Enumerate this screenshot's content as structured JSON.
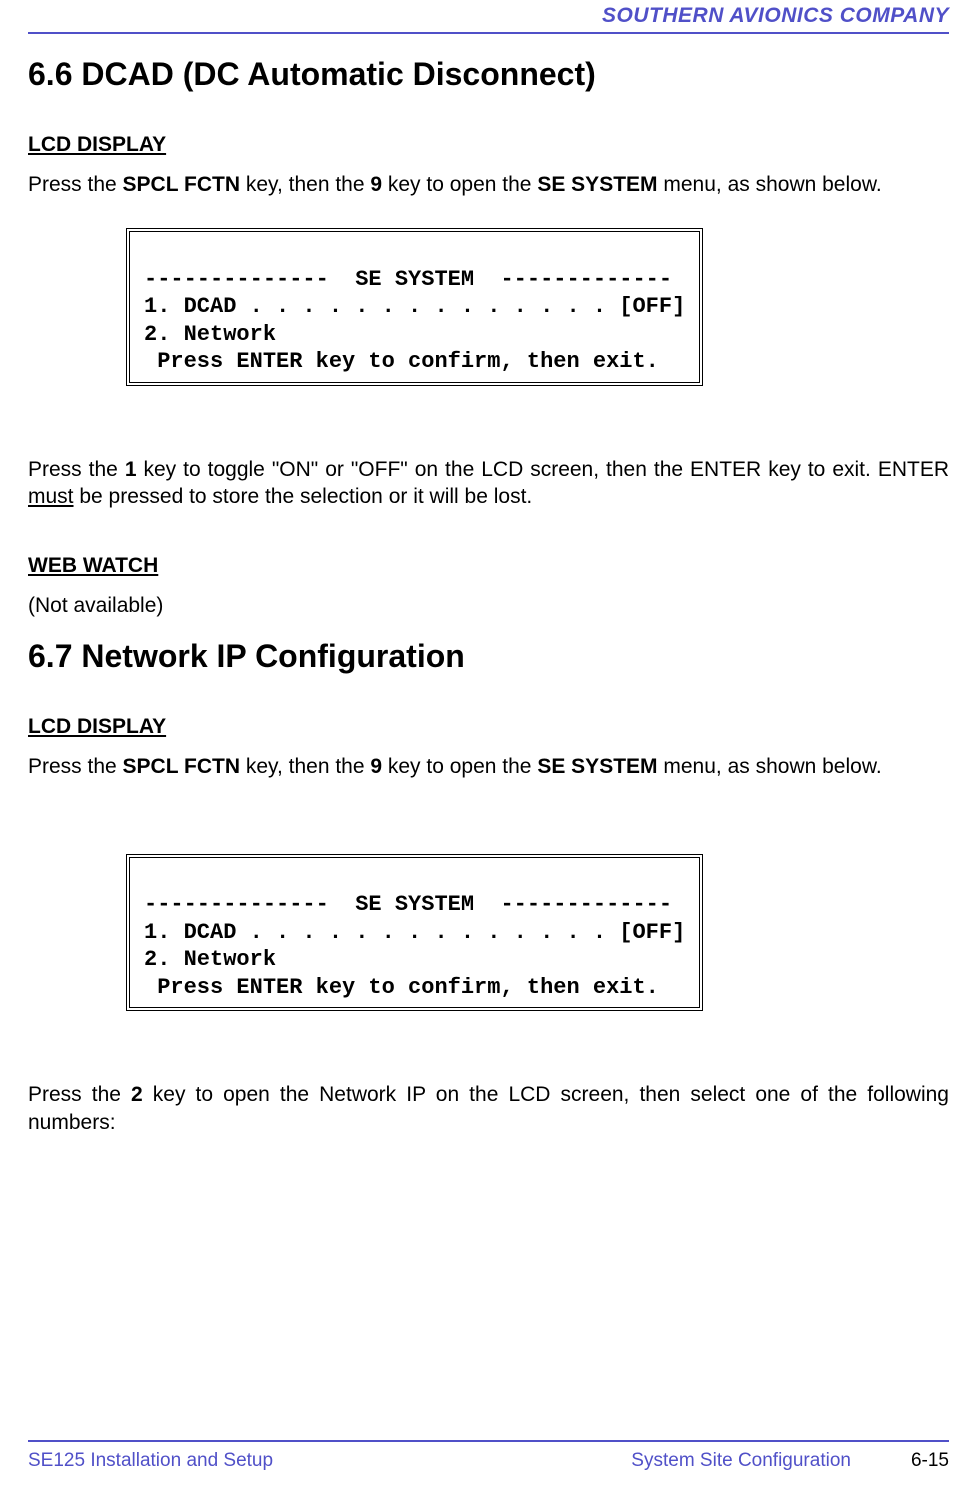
{
  "header": {
    "company": "SOUTHERN AVIONICS COMPANY"
  },
  "section66": {
    "heading": "6.6  DCAD (DC Automatic Disconnect)",
    "lcd_label": "LCD DISPLAY",
    "intro_1a": "Press the ",
    "intro_1b": "SPCL FCTN",
    "intro_1c": " key, then the ",
    "intro_1d": "9",
    "intro_1e": " key to open the ",
    "intro_1f": "SE SYSTEM",
    "intro_1g": "  menu, as shown below.",
    "lcd_line1": "--------------  SE SYSTEM  -------------",
    "lcd_line2": "1. DCAD . . . . . . . . . . . . . . [OFF]",
    "lcd_line3": "2. Network",
    "lcd_line4": " Press ENTER key to confirm, then exit.",
    "after_1a": "Press the ",
    "after_1b": "1",
    "after_1c": " key to toggle \"ON\" or \"OFF\" on the LCD screen, then the ENTER key to exit.  ENTER ",
    "after_1d": "must",
    "after_1e": " be pressed to store the selection or it will be lost.",
    "web_label": "WEB WATCH",
    "web_text": "(Not available)"
  },
  "section67": {
    "heading": "6.7  Network IP Configuration",
    "lcd_label": "LCD DISPLAY",
    "intro_1a": "Press the ",
    "intro_1b": "SPCL FCTN",
    "intro_1c": " key, then the ",
    "intro_1d": "9",
    "intro_1e": " key to open the ",
    "intro_1f": "SE SYSTEM",
    "intro_1g": " menu, as shown below.",
    "lcd_line1": "--------------  SE SYSTEM  -------------",
    "lcd_line2": "1. DCAD . . . . . . . . . . . . . . [OFF]",
    "lcd_line3": "2. Network",
    "lcd_line4": " Press ENTER key to confirm, then exit.",
    "after_1a": "Press the ",
    "after_1b": "2",
    "after_1c": " key to open the Network IP on the LCD screen, then select one of the following numbers:"
  },
  "footer": {
    "left": "SE125 Installation and Setup",
    "center": "System Site Configuration",
    "right": "6-15"
  }
}
